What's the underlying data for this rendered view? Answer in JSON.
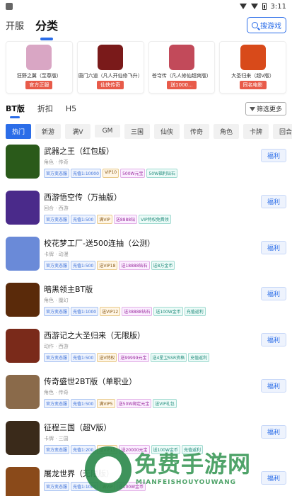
{
  "status": {
    "time": "3:11"
  },
  "top_tabs": [
    {
      "label": "开服",
      "active": false
    },
    {
      "label": "分类",
      "active": true
    }
  ],
  "search_label": "搜游戏",
  "featured": [
    {
      "name": "狂野之翼（至尊版）",
      "tag": "官方正服",
      "color": "#d9a6c4"
    },
    {
      "name": "唐门六道（凡人开仙修飞升）",
      "tag": "仙侠传奇",
      "color": "#7a1a1a"
    },
    {
      "name": "苍穹传（凡人修仙超爽版）",
      "tag": "送1000...",
      "color": "#c24a5a"
    },
    {
      "name": "大圣归来（超V版）",
      "tag": "同名电影",
      "color": "#d84a1a"
    }
  ],
  "sub_tabs": [
    {
      "label": "BT版",
      "active": true
    },
    {
      "label": "折扣",
      "active": false
    },
    {
      "label": "H5",
      "active": false
    }
  ],
  "filter_label": "筛选更多",
  "categories": [
    {
      "label": "热门",
      "active": true
    },
    {
      "label": "新游",
      "active": false
    },
    {
      "label": "满V",
      "active": false
    },
    {
      "label": "GM",
      "active": false
    },
    {
      "label": "三国",
      "active": false
    },
    {
      "label": "仙侠",
      "active": false
    },
    {
      "label": "传奇",
      "active": false
    },
    {
      "label": "角色",
      "active": false
    },
    {
      "label": "卡牌",
      "active": false
    },
    {
      "label": "回合",
      "active": false
    },
    {
      "label": "西",
      "active": false
    }
  ],
  "welfare_label": "福利",
  "games": [
    {
      "title": "武器之王（红包版）",
      "genre": "角色 · 传奇",
      "color": "#2a5a1a",
      "tags": [
        "官方变态服",
        "充值1:10000",
        "VIP10",
        "500W元宝",
        "50W福利钻石"
      ]
    },
    {
      "title": "西游悟空传（万抽版）",
      "genre": "回合 · 西游",
      "color": "#4a2a8a",
      "tags": [
        "官方变态服",
        "充值1:500",
        "满VIP",
        "送8888钻",
        "VIP特权免费领"
      ]
    },
    {
      "title": "校花梦工厂-送500连抽（公测）",
      "genre": "卡牌 · 动漫",
      "color": "#6a8ad8",
      "tags": [
        "官方变态服",
        "充值1:500",
        "送VIP18",
        "送18888钻石",
        "送8万金币"
      ]
    },
    {
      "title": "暗黑领主BT版",
      "genre": "角色 · 魔幻",
      "color": "#5a2a0a",
      "tags": [
        "官方变态服",
        "充值1:1000",
        "送VIP12",
        "送38888钻石",
        "送100W金币",
        "充值返利"
      ]
    },
    {
      "title": "西游记之大圣归来（无限版）",
      "genre": "动作 · 西游",
      "color": "#7a2a1a",
      "tags": [
        "官方变态服",
        "充值1:500",
        "送V特权",
        "送99999元宝",
        "送4星卫SSR资格",
        "充值返利"
      ]
    },
    {
      "title": "传奇盛世2BT版（单职业）",
      "genre": "角色 · 传奇",
      "color": "#8a6a4a",
      "tags": [
        "官方变态服",
        "充值1:500",
        "满VIP5",
        "送50W绑定元宝",
        "送VIP礼包"
      ]
    },
    {
      "title": "征程三国（超V版）",
      "genre": "卡牌 · 三国",
      "color": "#3a2a1a",
      "tags": [
        "官方变态服",
        "充值1:200",
        "送VIP15",
        "送20000元宝",
        "送100W金币",
        "充值返利"
      ]
    },
    {
      "title": "屠龙世界（无限版）",
      "genre": "",
      "color": "#8a4a1a",
      "tags": [
        "官方变态服",
        "充值1:1000",
        "满VIP",
        "送100W金币"
      ]
    }
  ],
  "watermark": {
    "main": "免费手游网",
    "sub": "MIANFEISHOUYOUWANG"
  }
}
